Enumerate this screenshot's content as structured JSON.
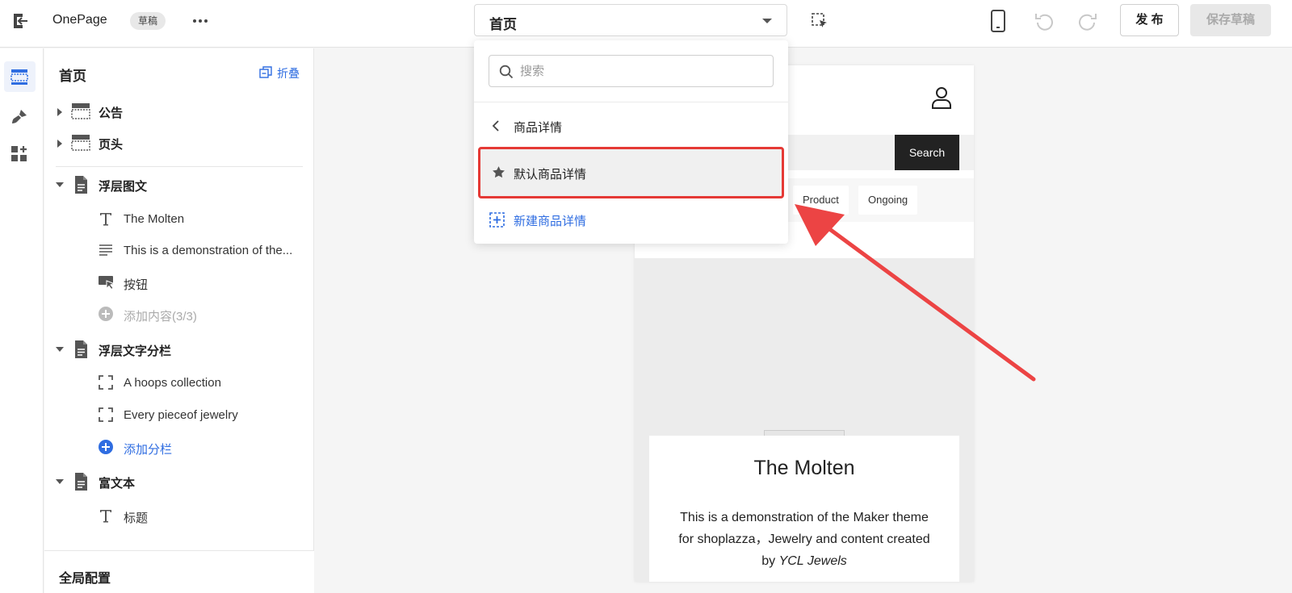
{
  "topbar": {
    "app_name": "OnePage",
    "draft_badge": "草稿",
    "page_select_value": "首页",
    "publish_label": "发 布",
    "save_draft_label": "保存草稿"
  },
  "panel": {
    "title": "首页",
    "collapse_label": "折叠",
    "sections": [
      {
        "label": "公告"
      },
      {
        "label": "页头"
      },
      {
        "label": "浮层图文",
        "children": [
          "The Molten",
          "This is a demonstration of the...",
          "按钮",
          "添加内容(3/3)"
        ]
      },
      {
        "label": "浮层文字分栏",
        "children": [
          "A hoops collection",
          "Every pieceof jewelry",
          "添加分栏"
        ]
      },
      {
        "label": "富文本",
        "children": [
          "标题"
        ]
      }
    ],
    "footer_label": "全局配置"
  },
  "dropdown": {
    "search_placeholder": "搜索",
    "back_label": "商品详情",
    "default_option": "默认商品详情",
    "new_option": "新建商品详情"
  },
  "preview": {
    "search_button": "Search",
    "tags": [
      "Product",
      "Ongoing"
    ],
    "hero_title": "The Molten",
    "hero_text_line": "This is a demonstration of the Maker theme for shoplazza，Jewelry and content created by",
    "hero_text_brand": "YCL Jewels"
  },
  "colors": {
    "accent": "#2f6de1",
    "highlight": "#e53935",
    "annotation_arrow": "#ec4444"
  }
}
